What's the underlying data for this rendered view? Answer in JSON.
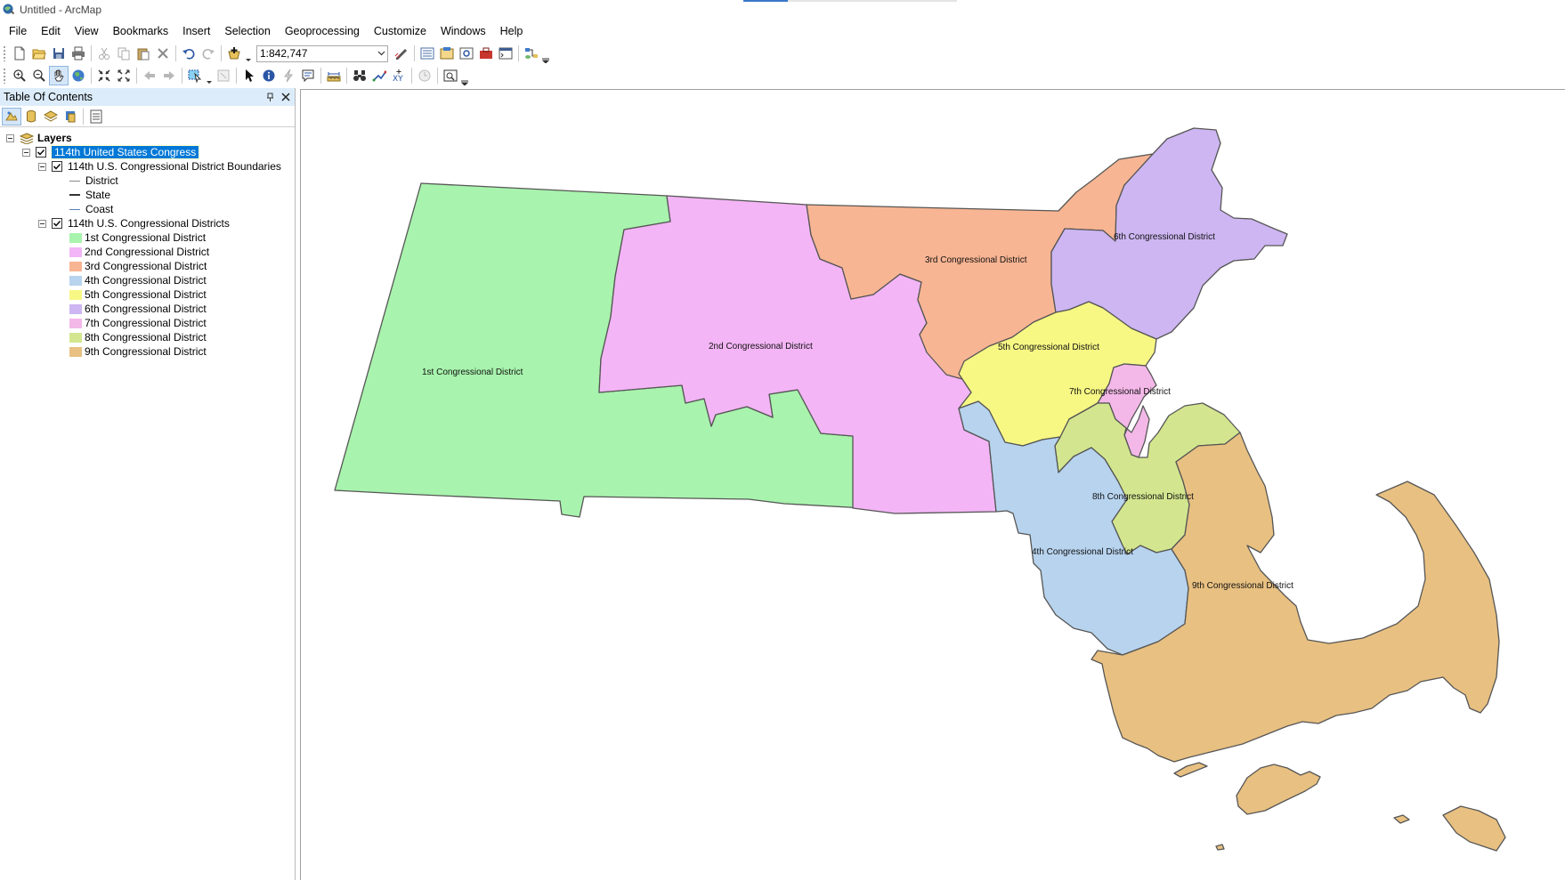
{
  "window": {
    "title": "Untitled - ArcMap"
  },
  "menu": [
    "File",
    "Edit",
    "View",
    "Bookmarks",
    "Insert",
    "Selection",
    "Geoprocessing",
    "Customize",
    "Windows",
    "Help"
  ],
  "toolbar": {
    "scale_value": "1:842,747"
  },
  "toc": {
    "title": "Table Of Contents",
    "root_label": "Layers",
    "group_label": "114th United States Congress",
    "boundaries_layer": {
      "label": "114th U.S. Congressional District Boundaries",
      "legend": [
        {
          "label": "District",
          "color": "#8a8a8a"
        },
        {
          "label": "State",
          "color": "#333333"
        },
        {
          "label": "Coast",
          "color": "#5b84b7"
        }
      ]
    },
    "districts_layer": {
      "label": "114th U.S. Congressional Districts",
      "legend": [
        {
          "label": "1st Congressional District",
          "color": "#a8f3ad"
        },
        {
          "label": "2nd Congressional District",
          "color": "#f3b5f5"
        },
        {
          "label": "3rd Congressional District",
          "color": "#f8b593"
        },
        {
          "label": "4th Congressional District",
          "color": "#b7d3ee"
        },
        {
          "label": "5th Congressional District",
          "color": "#f7f784"
        },
        {
          "label": "6th Congressional District",
          "color": "#cdb6f2"
        },
        {
          "label": "7th Congressional District",
          "color": "#f4b8e8"
        },
        {
          "label": "8th Congressional District",
          "color": "#d3e68f"
        },
        {
          "label": "9th Congressional District",
          "color": "#e8c081"
        }
      ]
    }
  },
  "map": {
    "labels": [
      "1st Congressional District",
      "2nd Congressional District",
      "3rd Congressional District",
      "4th Congressional District",
      "5th Congressional District",
      "6th Congressional District",
      "7th Congressional District",
      "8th Congressional District",
      "9th Congressional District"
    ]
  }
}
